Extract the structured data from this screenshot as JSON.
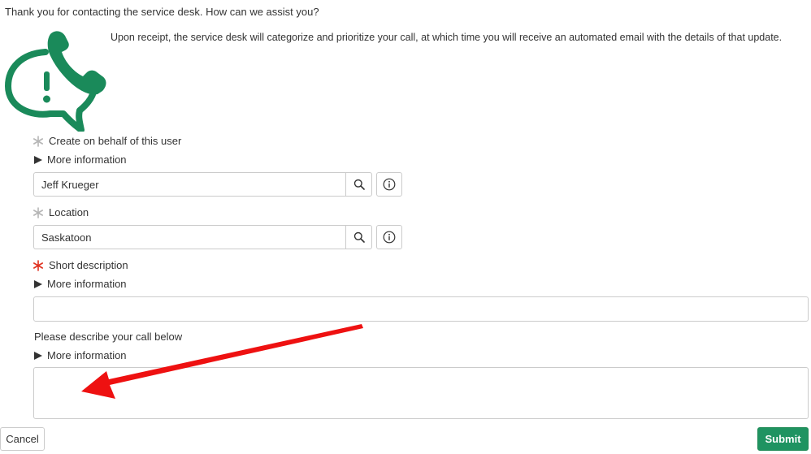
{
  "header": {
    "title": "Thank you for contacting the service desk. How can we assist you?",
    "intro": "Upon receipt, the service desk will categorize and prioritize your call, at which time you will receive an automated email with the details of that update."
  },
  "form": {
    "on_behalf": {
      "label": "Create on behalf of this user",
      "more_info": "More information",
      "value": "Jeff Krueger"
    },
    "location": {
      "label": "Location",
      "value": "Saskatoon"
    },
    "short_description": {
      "label": "Short description",
      "more_info": "More information",
      "value": ""
    },
    "description": {
      "label": "Please describe your call below",
      "more_info": "More information",
      "value": ""
    }
  },
  "buttons": {
    "cancel": "Cancel",
    "submit": "Submit"
  },
  "colors": {
    "brand": "#1a8a5a",
    "required_star": "#e0301e",
    "optional_star": "#b5b5b5",
    "submit_bg": "#1f9361",
    "annotation_arrow": "#ee1111"
  },
  "icons": {
    "logo": "phone-alert-bubble-icon",
    "search": "search-icon",
    "info": "info-icon",
    "expand": "triangle-right-icon"
  }
}
